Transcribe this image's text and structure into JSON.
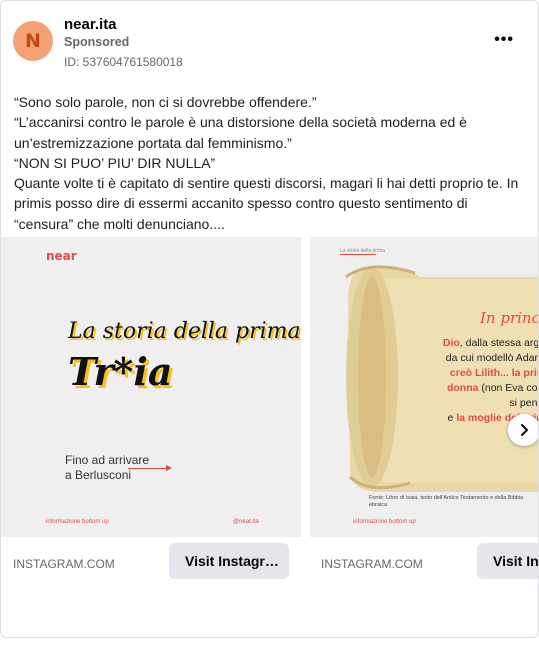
{
  "header": {
    "avatar_letter": "N",
    "page_name": "near.ita",
    "sponsored": "Sponsored",
    "ad_id": "ID: 537604761580018",
    "more_label": "•••"
  },
  "body": {
    "lines": [
      "“Sono solo parole, non ci si dovrebbe offendere.”",
      "“L’accanirsi contro le parole è una distorsione della società moderna ed è un’estremizzazione portata dal femminismo.”",
      "“NON SI PUO’ PIU’ DIR NULLA”",
      "Quante volte ti è capitato di sentire questi discorsi, magari li hai detti proprio te. In primis posso dire di essermi accanito spesso contro questo sentimento di “censura” che molti denunciano...."
    ]
  },
  "slides": [
    {
      "brand": "near",
      "title_line1": "La storia della prima",
      "title_line2": "Tr*ia",
      "subtitle_line1": "Fino ad arrivare",
      "subtitle_line2": "a Berlusconi",
      "footer_left": "informazione bottom up",
      "footer_right": "@near.ita",
      "domain": "INSTAGRAM.COM",
      "cta": "Visit Instagr…"
    },
    {
      "top_text": "La storia della prima",
      "heading": "In principio",
      "text_lines": [
        {
          "pre": "",
          "bold_red": "Dio",
          "post": ", dalla stessa argilla"
        },
        {
          "pre": "da cui modellò Adamo,",
          "bold_red": "",
          "post": ""
        },
        {
          "pre": "",
          "bold_red": "creò Lilith... la prima",
          "post": ""
        },
        {
          "pre": "",
          "bold_red": "donna",
          "post": " (non Eva come"
        },
        {
          "pre": "si pensa)",
          "bold_red": "",
          "post": ""
        },
        {
          "pre": "e ",
          "bold_red": "la moglie del primo",
          "post": ""
        }
      ],
      "source": "Fonte: Libro di Isaia, testo dell'Antico Testamento e della Bibbia ebraica",
      "footer_left": "informazione bottom up",
      "domain": "INSTAGRAM.COM",
      "cta": "Visit Instagram"
    }
  ],
  "icons": {
    "next": "chevron-right-icon"
  },
  "colors": {
    "accent_red": "#e14a4a",
    "highlight_yellow": "#f3c21f",
    "avatar_bg": "#f6a173",
    "button_bg": "#e4e6eb"
  }
}
